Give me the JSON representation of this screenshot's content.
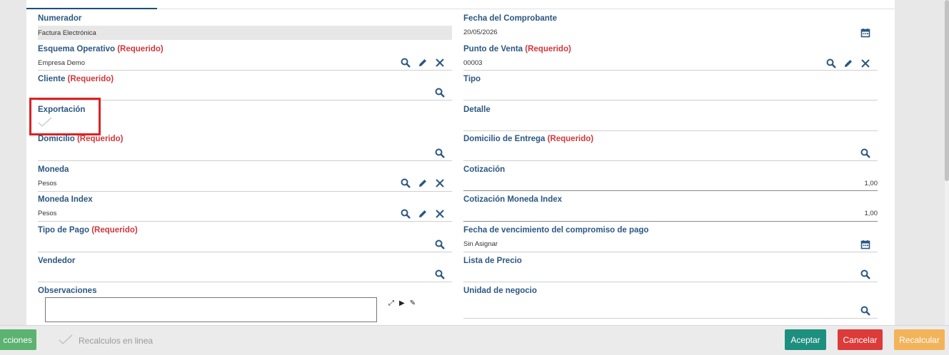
{
  "colors": {
    "label": "#2b5782",
    "required": "#d0373b",
    "icon": "#2b5782",
    "accept": "#1d8f7e",
    "cancel": "#dd3a3a",
    "recalc": "#f2b35a",
    "actions": "#5cb270"
  },
  "left": {
    "numerador": {
      "label": "Numerador",
      "value": "Factura Electrónica"
    },
    "esquema": {
      "label": "Esquema Operativo",
      "required": "(Requerido)",
      "value": "Empresa Demo"
    },
    "cliente": {
      "label": "Cliente",
      "required": "(Requerido)",
      "value": ""
    },
    "exportacion": {
      "label": "Exportación"
    },
    "domicilio": {
      "label": "Domicilio",
      "required": "(Requerido)",
      "value": ""
    },
    "moneda": {
      "label": "Moneda",
      "value": "Pesos"
    },
    "moneda_index": {
      "label": "Moneda Index",
      "value": "Pesos"
    },
    "tipo_pago": {
      "label": "Tipo de Pago",
      "required": "(Requerido)",
      "value": ""
    },
    "vendedor": {
      "label": "Vendedor",
      "value": ""
    },
    "observaciones": {
      "label": "Observaciones",
      "value": ""
    }
  },
  "right": {
    "fecha": {
      "label": "Fecha del Comprobante",
      "value": "20/05/2026"
    },
    "punto_venta": {
      "label": "Punto de Venta",
      "required": "(Requerido)",
      "value": "00003"
    },
    "tipo": {
      "label": "Tipo",
      "value": ""
    },
    "detalle": {
      "label": "Detalle",
      "value": ""
    },
    "domicilio_entrega": {
      "label": "Domicilio de Entrega",
      "required": "(Requerido)",
      "value": ""
    },
    "cotizacion": {
      "label": "Cotización",
      "value": "1,00"
    },
    "cotizacion_index": {
      "label": "Cotización Moneda Index",
      "value": "1,00"
    },
    "vencimiento": {
      "label": "Fecha de vencimiento del compromiso de pago",
      "value": "Sin Asignar"
    },
    "lista_precio": {
      "label": "Lista de Precio",
      "value": ""
    },
    "unidad_negocio": {
      "label": "Unidad de negocio",
      "value": ""
    }
  },
  "footer": {
    "actions_label": "cciones",
    "recalc_online_label": "Recalculos en linea",
    "accept_label": "Aceptar",
    "cancel_label": "Cancelar",
    "recalc_label": "Recalcular"
  }
}
